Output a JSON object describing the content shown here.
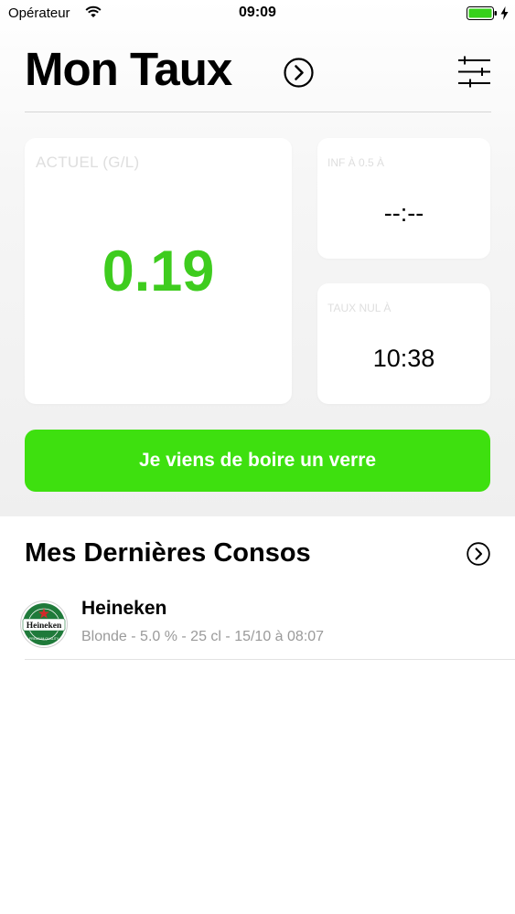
{
  "status_bar": {
    "carrier": "Opérateur",
    "time": "09:09"
  },
  "header": {
    "title": "Mon Taux",
    "icons": [
      "chevron-right-circle-icon",
      "sliders-icon"
    ]
  },
  "cards": {
    "current": {
      "label": "ACTUEL (g/L)",
      "value": "0.19",
      "value_color": "#3ecc1e"
    },
    "below_limit": {
      "label": "INF À 0.5 À",
      "value": "--:--"
    },
    "zero_rate": {
      "label": "TAUX NUL À",
      "value": "10:38"
    }
  },
  "main_button": {
    "label": "Je viens de boire un verre",
    "color": "#3ee00f"
  },
  "recent": {
    "title": "Mes Dernières Consos",
    "items": [
      {
        "name": "Heineken",
        "details": "Blonde - 5.0 % - 25 cl - 15/10 à 08:07",
        "logo": "heineken-logo"
      }
    ]
  },
  "logo_text": {
    "brand": "Heineken"
  }
}
